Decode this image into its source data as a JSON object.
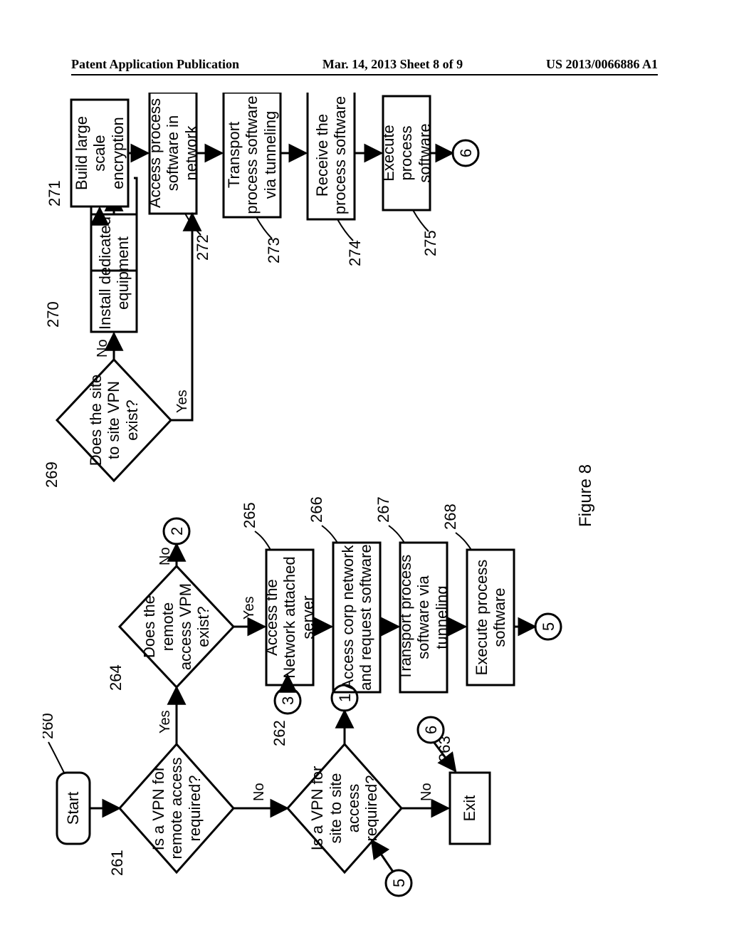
{
  "header": {
    "left": "Patent Application Publication",
    "center": "Mar. 14, 2013  Sheet 8 of 9",
    "right": "US 2013/0066886 A1"
  },
  "figure_label": "Figure 8",
  "edge_labels": {
    "yes": "Yes",
    "no": "No"
  },
  "refs": {
    "r260": "260",
    "r261": "261",
    "r262": "262",
    "r263": "263",
    "r264": "264",
    "r265": "265",
    "r266": "266",
    "r267": "267",
    "r268": "268",
    "r269": "269",
    "r270": "270",
    "r271": "271",
    "r272": "272",
    "r273": "273",
    "r274": "274",
    "r275": "275"
  },
  "connectors": {
    "c1": "1",
    "c2": "2",
    "c3": "3",
    "c5": "5",
    "c6": "6"
  },
  "nodes": {
    "start": "Start",
    "d261": "Is a VPN for remote access required?",
    "d262": "Is a VPN for site to site access required?",
    "exit": "Exit",
    "d264": "Does the remote access VPM exist?",
    "b265": "Access the Network attached server",
    "b266": "Access corp network and request software",
    "b267": "Transport process software via tunneling",
    "b268": "Execute process software",
    "d269": "Does the site to site VPN exist?",
    "b270": "Install dedicated equipment",
    "b271": "Build large scale encryption",
    "b272": "Access process software in network",
    "b273": "Transport process software via tunneling",
    "b274": "Receive the process software",
    "b275": "Execute process software"
  }
}
